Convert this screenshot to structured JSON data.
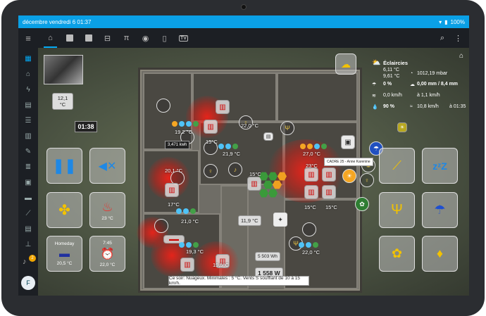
{
  "status_bar": {
    "datetime": "décembre vendredi 6 01:37",
    "battery": "100%"
  },
  "topnav": {
    "tabs": [
      {
        "name": "home",
        "glyph": "⌂"
      },
      {
        "name": "square-1",
        "glyph": ""
      },
      {
        "name": "square-2",
        "glyph": ""
      },
      {
        "name": "bed",
        "glyph": "▭"
      },
      {
        "name": "table",
        "glyph": "π"
      },
      {
        "name": "eye",
        "glyph": "◉"
      },
      {
        "name": "phone",
        "glyph": "▯"
      },
      {
        "name": "tv",
        "glyph": "TV"
      }
    ],
    "search_icon": "search-icon",
    "menu_icon": "more-vert-icon"
  },
  "sidebar": {
    "notifications_count": "2",
    "avatar_letter": "F"
  },
  "camera": {
    "temp": "12,1 °C"
  },
  "clock": {
    "time": "01:38"
  },
  "controls": {
    "vent_label": "23 °C",
    "homeday_top": "Homeday",
    "homeday_label": "20,5 °C",
    "alarm_top": "7:45",
    "alarm_label": "22,0 °C"
  },
  "weather": {
    "condition": "Éclaircies",
    "temp_max": "6,11 °C",
    "temp_min": "9,61 °C",
    "pressure": "1012,19 mbar",
    "rain_pct": "0 %",
    "rain_mm": "0,00 mm",
    "wind_dir": "/ 8,4 mm",
    "wind_speed": "0,0 km/h",
    "wind_time": "à 1,1 km/h",
    "humidity": "90 %",
    "gust": "10,8 km/h",
    "gust_time": "à 01:35"
  },
  "floorplan": {
    "temps": {
      "kitchen_top": "22,0 °C",
      "room_a": "19,2 °C",
      "room_a_low": "15°C",
      "living": "21,9 °C",
      "living_low": "15°C",
      "office": "27,0 °C",
      "office_low1": "23°C",
      "office_low2": "15°C",
      "bath": "20,1 °C",
      "bath_low": "17°C",
      "hall": "21,0 °C",
      "bed1": "19,3 °C",
      "bed1_low": "19,5°C",
      "bed2": "22,0 °C",
      "corridor": "11,9 °C",
      "kwh": "3,471 kwh",
      "mid_badge": "15°C"
    },
    "energy": {
      "wh": "5 503 Wh",
      "w": "1 558 W"
    },
    "tooltip": "CADRE 25 - Anne Karenine"
  },
  "forecast": "Ce soir: Nuageux. Minimales : 5 °C. Vents S soufflant de 10 à 15 km/h."
}
